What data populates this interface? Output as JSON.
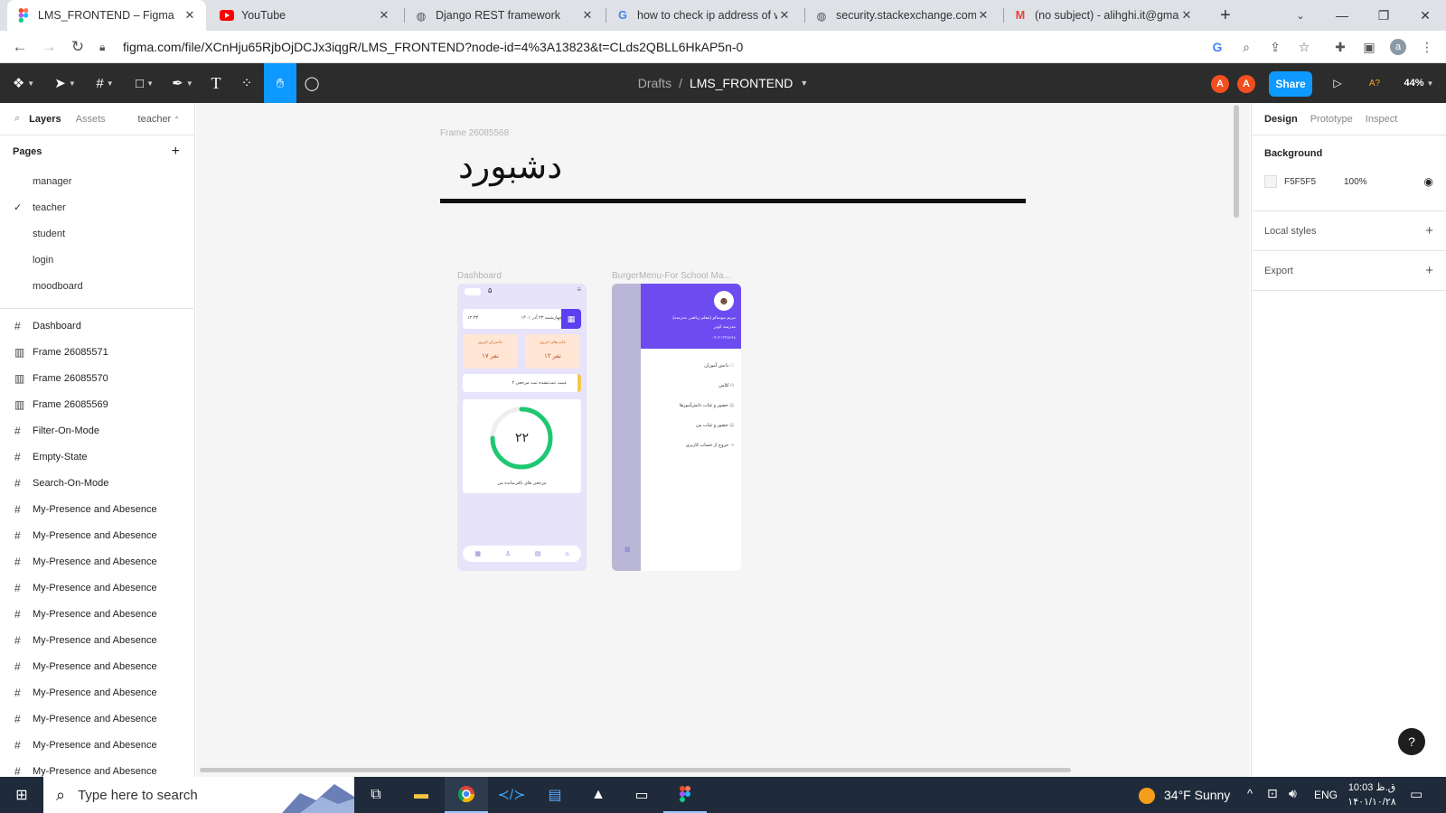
{
  "browser": {
    "tabs": [
      {
        "title": "LMS_FRONTEND – Figma",
        "icon": "figma-icon",
        "active": true
      },
      {
        "title": "YouTube",
        "icon": "youtube-icon"
      },
      {
        "title": "Django REST framework",
        "icon": "globe-icon"
      },
      {
        "title": "how to check ip address of w",
        "icon": "google-icon"
      },
      {
        "title": "security.stackexchange.com",
        "icon": "globe-icon"
      },
      {
        "title": "(no subject) - alihghi.it@gma",
        "icon": "gmail-icon"
      }
    ],
    "url": "figma.com/file/XCnHju65RjbOjDCJx3iqgR/LMS_FRONTEND?node-id=4%3A13823&t=CLds2QBLL6HkAP5n-0",
    "profile_initial": "a"
  },
  "figma": {
    "breadcrumb": {
      "drafts": "Drafts",
      "file": "LMS_FRONTEND"
    },
    "avatars": [
      "A",
      "A"
    ],
    "share_label": "Share",
    "ai_label": "A?",
    "zoom": "44%",
    "left_tabs": {
      "layers": "Layers",
      "assets": "Assets",
      "page": "teacher"
    },
    "pages_title": "Pages",
    "pages": [
      "manager",
      "teacher",
      "student",
      "login",
      "moodboard"
    ],
    "layers": [
      {
        "name": "Dashboard",
        "icon": "#"
      },
      {
        "name": "Frame 26085571",
        "icon": "▥"
      },
      {
        "name": "Frame 26085570",
        "icon": "▥"
      },
      {
        "name": "Frame 26085569",
        "icon": "▥"
      },
      {
        "name": "Filter-On-Mode",
        "icon": "#"
      },
      {
        "name": "Empty-State",
        "icon": "#"
      },
      {
        "name": "Search-On-Mode",
        "icon": "#"
      },
      {
        "name": "My-Presence and Abesence",
        "icon": "#"
      },
      {
        "name": "My-Presence and Abesence",
        "icon": "#"
      },
      {
        "name": "My-Presence and Abesence",
        "icon": "#"
      },
      {
        "name": "My-Presence and Abesence",
        "icon": "#"
      },
      {
        "name": "My-Presence and Abesence",
        "icon": "#"
      },
      {
        "name": "My-Presence and Abesence",
        "icon": "#"
      },
      {
        "name": "My-Presence and Abesence",
        "icon": "#"
      },
      {
        "name": "My-Presence and Abesence",
        "icon": "#"
      },
      {
        "name": "My-Presence and Abesence",
        "icon": "#"
      },
      {
        "name": "My-Presence and Abesence",
        "icon": "#"
      },
      {
        "name": "My-Presence and Abesence",
        "icon": "#"
      }
    ],
    "right_tabs": {
      "design": "Design",
      "prototype": "Prototype",
      "inspect": "Inspect"
    },
    "background": {
      "label": "Background",
      "hex": "F5F5F5",
      "opacity": "100%"
    },
    "local_styles": "Local styles",
    "export": "Export",
    "canvas": {
      "frame_label": "Frame 26085568",
      "heading": "دشبورد",
      "dashboard_label": "Dashboard",
      "burger_label": "BurgerMenu-For School Ma...",
      "dash": {
        "top_num": "۵",
        "date": "چهارشنبه ۲۳ آذر ۱۴۰۱",
        "time": "۱۲:۳۳",
        "card1_title": "غایب‌های امروز",
        "card1_val": "۱۲ نفر",
        "card2_title": "حاضران امروز",
        "card2_val": "۱۷ نفر",
        "notice": "۲ غیبت ثبت‌نشده ثبت مرجعی",
        "gauge": "۲۲",
        "gauge_caption": "مرجعی های باقی‌مانده من"
      },
      "burger": {
        "name": "مریم موسالو (معلم ریاضی مدرسه)",
        "school": "مدرسه کوثر",
        "phone": "۰۹۱۲۱۳۴۵۶۷۸",
        "items": [
          "دانش آموزان",
          "کلاس",
          "حضور و غیاب دانش‌آموزها",
          "حضور و غیاب من",
          "خروج از حساب کاربری"
        ]
      }
    },
    "help": "?"
  },
  "taskbar": {
    "search_placeholder": "Type here to search",
    "weather": "34°F  Sunny",
    "lang": "ENG",
    "time": "10:03 ق.ظ",
    "date": "۱۴۰۱/۱۰/۲۸"
  }
}
